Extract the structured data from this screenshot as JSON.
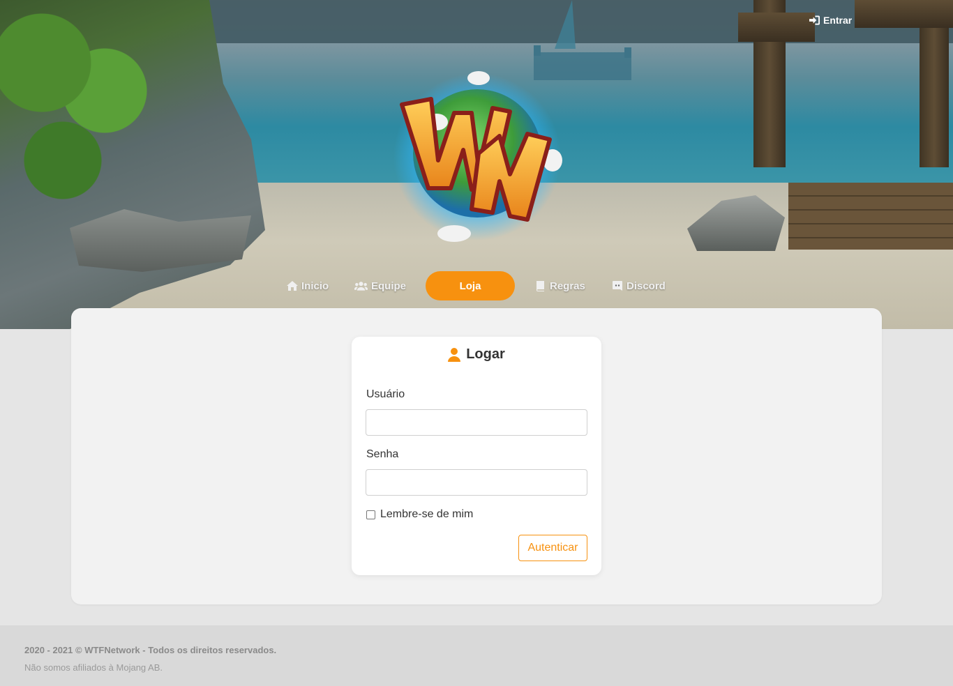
{
  "header": {
    "login_link": "Entrar"
  },
  "nav": {
    "items": [
      {
        "label": "Inicio",
        "icon": "home-icon"
      },
      {
        "label": "Equipe",
        "icon": "users-icon"
      },
      {
        "label": "Loja",
        "icon": "",
        "active": true
      },
      {
        "label": "Regras",
        "icon": "book-icon"
      },
      {
        "label": "Discord",
        "icon": "discord-icon"
      }
    ]
  },
  "login_card": {
    "title": "Logar",
    "username_label": "Usuário",
    "username_value": "",
    "password_label": "Senha",
    "password_value": "",
    "remember_label": "Lembre-se de mim",
    "remember_checked": false,
    "submit_label": "Autenticar"
  },
  "footer": {
    "copyright": "2020 - 2021 © WTFNetwork - Todos os direitos reservados.",
    "disclaimer": "Não somos afiliados à Mojang AB."
  },
  "colors": {
    "accent": "#f7910f",
    "panel_bg": "#f2f2f2",
    "page_bg": "#e5e5e5",
    "footer_bg": "#d9d9d9"
  }
}
